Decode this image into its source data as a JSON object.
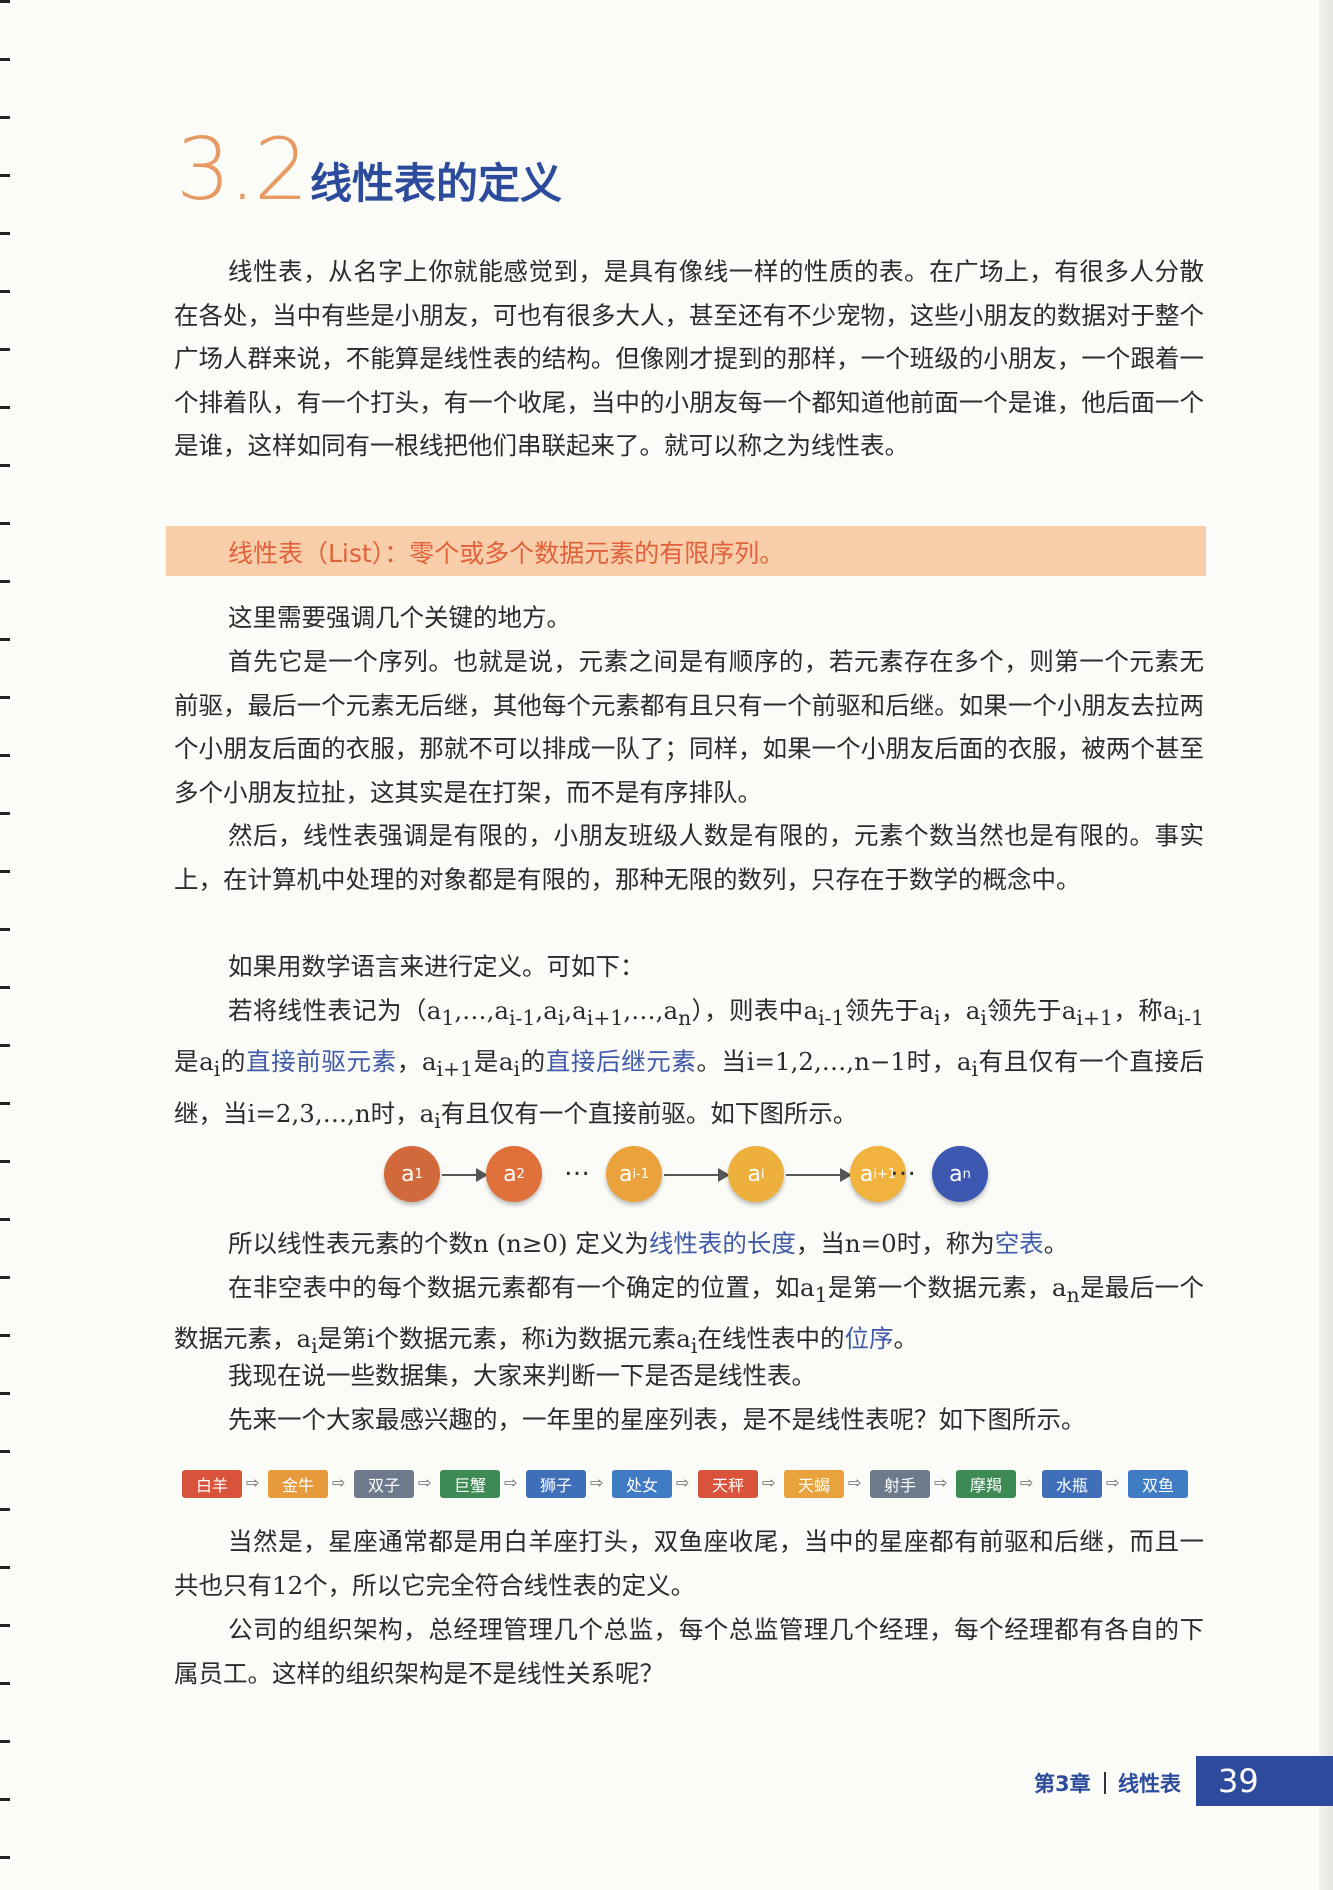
{
  "section": {
    "number": "3.2",
    "title": "线性表的定义"
  },
  "para1": "线性表，从名字上你就能感觉到，是具有像线一样的性质的表。在广场上，有很多人分散在各处，当中有些是小朋友，可也有很多大人，甚至还有不少宠物，这些小朋友的数据对于整个广场人群来说，不能算是线性表的结构。但像刚才提到的那样，一个班级的小朋友，一个跟着一个排着队，有一个打头，有一个收尾，当中的小朋友每一个都知道他前面一个是谁，他后面一个是谁，这样如同有一根线把他们串联起来了。就可以称之为线性表。",
  "definition": "线性表（List）：零个或多个数据元素的有限序列。",
  "para2": "这里需要强调几个关键的地方。",
  "para3": "首先它是一个序列。也就是说，元素之间是有顺序的，若元素存在多个，则第一个元素无前驱，最后一个元素无后继，其他每个元素都有且只有一个前驱和后继。如果一个小朋友去拉两个小朋友后面的衣服，那就不可以排成一队了；同样，如果一个小朋友后面的衣服，被两个甚至多个小朋友拉扯，这其实是在打架，而不是有序排队。",
  "para4": "然后，线性表强调是有限的，小朋友班级人数是有限的，元素个数当然也是有限的。事实上，在计算机中处理的对象都是有限的，那种无限的数列，只存在于数学的概念中。",
  "para5": "如果用数学语言来进行定义。可如下：",
  "math": {
    "s1": "若将线性表记为（a",
    "s2": ",…,a",
    "s3": ",a",
    "s4": ",a",
    "s5": ",…,a",
    "s6": "），则表中a",
    "s7": "领先于a",
    "s8": "，a",
    "s9": "领先于a",
    "s10": "，称a",
    "s11": "是a",
    "s12": "的",
    "hl1": "直接前驱元素",
    "s13": "，a",
    "s14": "是a",
    "s15": "的",
    "hl2": "直接后继元素",
    "s16": "。当i=1,2,…,n−1时，a",
    "s17": "有且仅有一个直接后继，当i=2,3,…,n时，a",
    "s18": "有且仅有一个直接前驱。如下图所示。"
  },
  "sub": {
    "one": "1",
    "im1": "i-1",
    "i": "i",
    "ip1": "i+1",
    "n": "n"
  },
  "sequence": {
    "nodes": [
      {
        "letter": "a",
        "sub": "1",
        "color": "#d2693a"
      },
      {
        "letter": "a",
        "sub": "2",
        "color": "#e0703a"
      },
      {
        "letter": "a",
        "sub": "i-1",
        "color": "#eaa23c"
      },
      {
        "letter": "a",
        "sub": "i",
        "color": "#eeb03c"
      },
      {
        "letter": "a",
        "sub": "i+1",
        "color": "#f0b43e"
      },
      {
        "letter": "a",
        "sub": "n",
        "color": "#3c58b0"
      }
    ],
    "ellipsis": "…"
  },
  "para6": {
    "t1": "所以线性表元素的个数n (n≥0) 定义为",
    "hl1": "线性表的长度",
    "t2": "，当n=0时，称为",
    "hl2": "空表",
    "t3": "。"
  },
  "para7": {
    "t1": "在非空表中的每个数据元素都有一个确定的位置，如a",
    "t2": "是第一个数据元素，a",
    "t3": "是最后一个数据元素，a",
    "t4": "是第i个数据元素，称i为数据元素a",
    "t5": "在线性表中的",
    "hl": "位序",
    "t6": "。"
  },
  "para8": "我现在说一些数据集，大家来判断一下是否是线性表。",
  "para9": "先来一个大家最感兴趣的，一年里的星座列表，是不是线性表呢？如下图所示。",
  "zodiac": [
    {
      "label": "白羊",
      "color": "#d9523a"
    },
    {
      "label": "金牛",
      "color": "#e79a3c"
    },
    {
      "label": "双子",
      "color": "#6c7a8c"
    },
    {
      "label": "巨蟹",
      "color": "#3d8a55"
    },
    {
      "label": "狮子",
      "color": "#3f6fb8"
    },
    {
      "label": "处女",
      "color": "#3f7cc4"
    },
    {
      "label": "天秤",
      "color": "#d9523a"
    },
    {
      "label": "天蝎",
      "color": "#e9a33c"
    },
    {
      "label": "射手",
      "color": "#6c7a8c"
    },
    {
      "label": "摩羯",
      "color": "#3d8a55"
    },
    {
      "label": "水瓶",
      "color": "#3f6fb8"
    },
    {
      "label": "双鱼",
      "color": "#3f7cc4"
    }
  ],
  "para10": "当然是，星座通常都是用白羊座打头，双鱼座收尾，当中的星座都有前驱和后继，而且一共也只有12个，所以它完全符合线性表的定义。",
  "para11": "公司的组织架构，总经理管理几个总监，每个总监管理几个经理，每个经理都有各自的下属员工。这样的组织架构是不是线性关系呢？",
  "footer": {
    "chapter": "第3章",
    "title": "线性表",
    "page": "39"
  }
}
